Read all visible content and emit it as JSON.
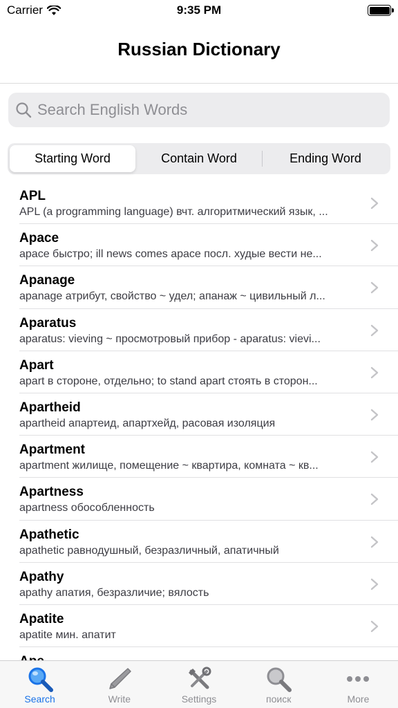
{
  "status_bar": {
    "carrier": "Carrier",
    "time": "9:35 PM"
  },
  "nav": {
    "title": "Russian Dictionary"
  },
  "search": {
    "placeholder": "Search English Words",
    "value": ""
  },
  "segments": [
    {
      "label": "Starting Word",
      "selected": true
    },
    {
      "label": "Contain Word",
      "selected": false
    },
    {
      "label": "Ending Word",
      "selected": false
    }
  ],
  "entries": [
    {
      "word": "APL",
      "definition": "APL (a programming language) вчт. алгоритмический язык, ..."
    },
    {
      "word": "Apace",
      "definition": "apace быстро; ill news comes apace посл. худые вести не..."
    },
    {
      "word": "Apanage",
      "definition": "apanage атрибут, свойство ~ удел; апанаж ~ цивильный л..."
    },
    {
      "word": "Aparatus",
      "definition": "aparatus: vieving ~ просмотровый прибор - aparatus: vievi..."
    },
    {
      "word": "Apart",
      "definition": "apart в стороне, отдельно; to stand apart стоять в сторон..."
    },
    {
      "word": "Apartheid",
      "definition": "apartheid апартеид, апартхейд, расовая изоляция"
    },
    {
      "word": "Apartment",
      "definition": "apartment жилище, помещение ~ квартира, комната ~ кв..."
    },
    {
      "word": "Apartness",
      "definition": "apartness обособленность"
    },
    {
      "word": "Apathetic",
      "definition": "apathetic равнодушный, безразличный, апатичный"
    },
    {
      "word": "Apathy",
      "definition": "apathy апатия, безразличие; вялость"
    },
    {
      "word": "Apatite",
      "definition": "apatite мин. апатит"
    },
    {
      "word": "Ape",
      "definition": ""
    }
  ],
  "tabs": [
    {
      "label": "Search",
      "icon": "magnifier-icon",
      "active": true
    },
    {
      "label": "Write",
      "icon": "pencil-icon",
      "active": false
    },
    {
      "label": "Settings",
      "icon": "tools-icon",
      "active": false
    },
    {
      "label": "поиск",
      "icon": "magnifier-icon",
      "active": false
    },
    {
      "label": "More",
      "icon": "more-dots-icon",
      "active": false
    }
  ],
  "colors": {
    "accent": "#1a73e8",
    "inactive": "#8e8e93"
  }
}
